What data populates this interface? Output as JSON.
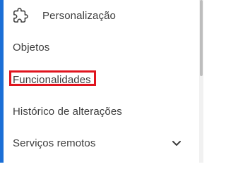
{
  "colors": {
    "accent_bar": "#1b6fd6",
    "highlight_box": "#e0141e",
    "text": "#3d3d3d"
  },
  "menu": {
    "items": [
      {
        "label": "Personalização",
        "icon": "puzzle-icon"
      },
      {
        "label": "Objetos"
      },
      {
        "label": "Funcionalidades",
        "highlighted": true
      },
      {
        "label": "Histórico de alterações"
      },
      {
        "label": "Serviços remotos",
        "icon": "chevron-down-icon"
      }
    ]
  }
}
